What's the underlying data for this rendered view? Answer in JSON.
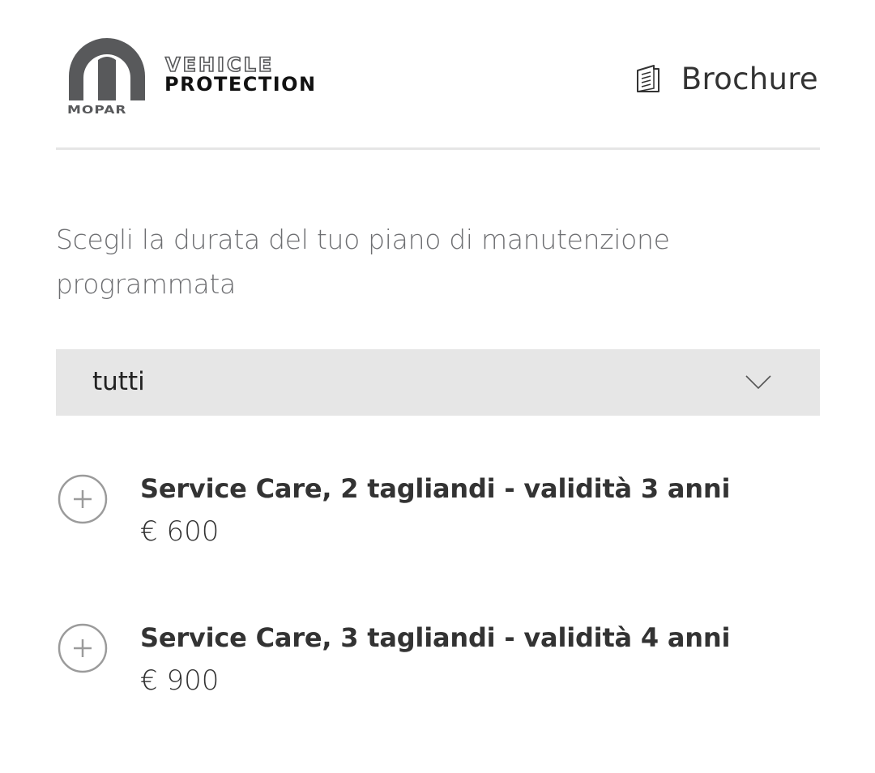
{
  "header": {
    "logo": {
      "mark_text": "MOPAR",
      "title_line1": "VEHICLE",
      "title_line2": "PROTECTION"
    },
    "brochure": {
      "label": "Brochure",
      "icon": "brochure-icon"
    }
  },
  "intro": {
    "text": "Scegli la durata del tuo piano di manutenzione programmata"
  },
  "filter": {
    "selected": "tutti",
    "icon": "chevron-down-icon"
  },
  "plans": [
    {
      "title": "Service Care, 2 tagliandi - validità 3 anni",
      "price": "€ 600",
      "icon": "plus-circle-icon"
    },
    {
      "title": "Service Care, 3 tagliandi - validità 4 anni",
      "price": "€ 900",
      "icon": "plus-circle-icon"
    }
  ],
  "colors": {
    "text_dark": "#333333",
    "text_muted": "#6d6e71",
    "logo_gray": "#58595b",
    "dropdown_bg": "#e6e6e6",
    "divider": "#e6e6e6",
    "icon_gray": "#9b9b9b"
  }
}
